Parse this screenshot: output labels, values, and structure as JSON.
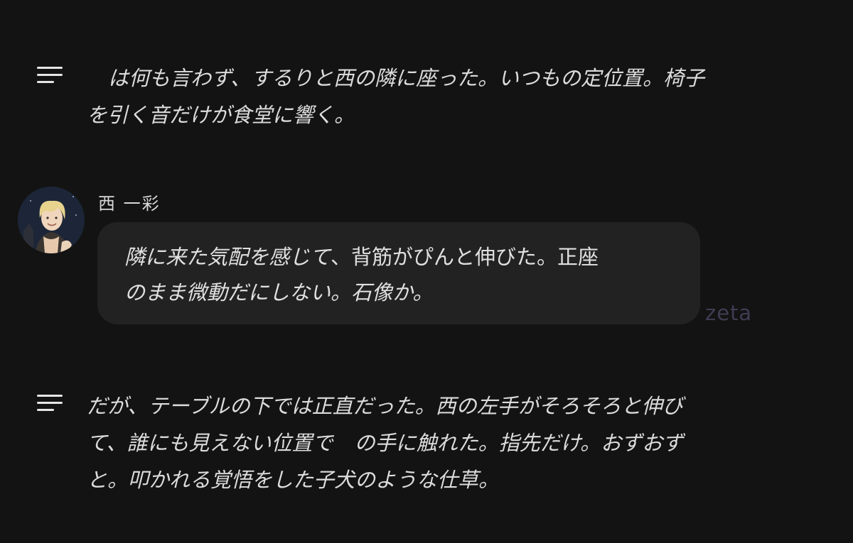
{
  "narration_1": {
    "line_1": "は何も言わず、するりと西の隣に座った。いつもの定位置。椅子",
    "line_2": "を引く音だけが食堂に響く。"
  },
  "message": {
    "speaker": "西 一彩",
    "avatar_icon": "character-portrait",
    "line_1_italic": "隣に来た気配を感じて",
    "line_1_rest": "、背筋がぴんと伸びた。正座",
    "line_2": "のまま微動だにしない。石像か。"
  },
  "watermark": "zeta",
  "narration_2": {
    "line_1": "だが、テーブルの下では正直だった。西の左手がそろそろと伸び",
    "line_2_before": "て、誰にも見えない位置で",
    "line_2_after": "の手に触れた。指先だけ。おずおず",
    "line_3": "と。叩かれる覚悟をした子犬のような仕草。"
  },
  "icons": {
    "narration": "menu-lines-icon"
  },
  "colors": {
    "background": "#131313",
    "bubble": "#222222",
    "text": "#dcdcdc",
    "watermark": "#3f3c52"
  }
}
